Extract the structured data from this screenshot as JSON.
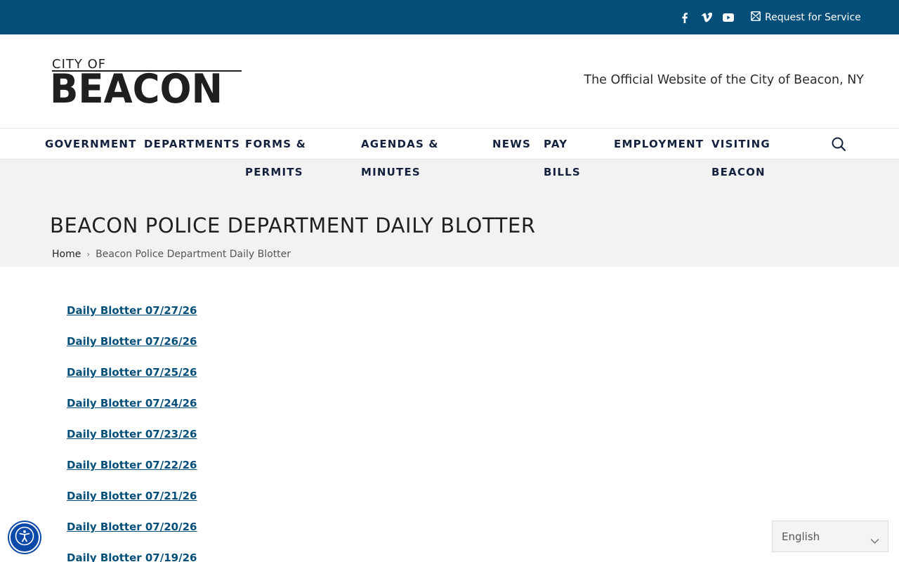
{
  "topbar": {
    "icons": [
      "facebook-icon",
      "vimeo-icon",
      "youtube-icon",
      "envelope-icon"
    ],
    "request_label": "Request for Service",
    "bg_color": "#034f7a"
  },
  "header": {
    "logo": {
      "top": "CITY OF",
      "main": "BEACON"
    },
    "tagline": "The Official Website of the City of Beacon, NY"
  },
  "nav": {
    "items": [
      {
        "line1": "GOVERNMENT",
        "line2": ""
      },
      {
        "line1": "DEPARTMENTS",
        "line2": ""
      },
      {
        "line1": "FORMS &",
        "line2": "PERMITS"
      },
      {
        "line1": "AGENDAS &",
        "line2": "MINUTES"
      },
      {
        "line1": "NEWS",
        "line2": ""
      },
      {
        "line1": "PAY",
        "line2": "BILLS"
      },
      {
        "line1": "EMPLOYMENT",
        "line2": ""
      },
      {
        "line1": "VISITING",
        "line2": "BEACON"
      }
    ],
    "search_icon": "search-icon"
  },
  "page": {
    "title": "BEACON POLICE DEPARTMENT DAILY BLOTTER",
    "breadcrumb": {
      "home": "Home",
      "separator": "›",
      "current": "Beacon Police Department Daily Blotter"
    }
  },
  "blotters": [
    "Daily Blotter 07/27/26",
    "Daily Blotter 07/26/26",
    "Daily Blotter 07/25/26",
    "Daily Blotter 07/24/26",
    "Daily Blotter 07/23/26",
    "Daily Blotter 07/22/26",
    "Daily Blotter 07/21/26",
    "Daily Blotter 07/20/26",
    "Daily Blotter 07/19/26"
  ],
  "widgets": {
    "accessibility_icon": "accessibility-icon",
    "language": {
      "selected": "English"
    }
  },
  "colors": {
    "brand": "#034f7a",
    "nav_text": "#14213d",
    "title_band": "#f2f2f2",
    "a11y": "#0b4aa8"
  }
}
